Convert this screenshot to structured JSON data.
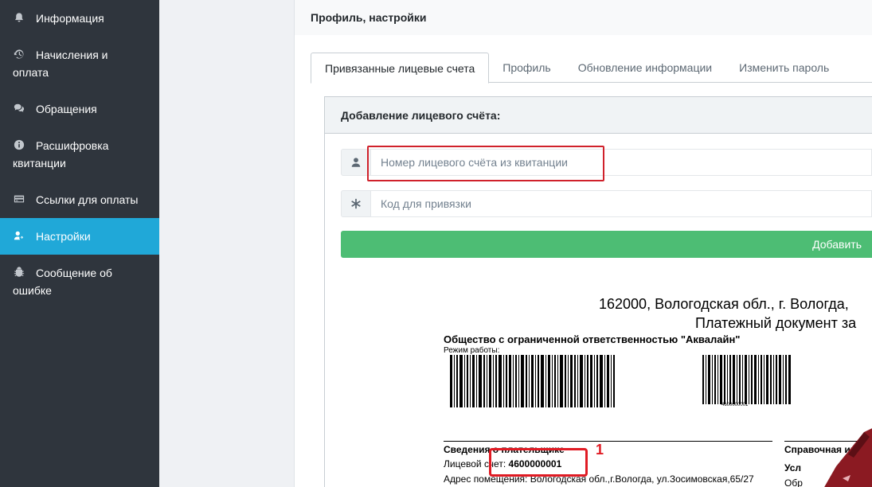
{
  "sidebar": {
    "items": [
      {
        "label": "Информация",
        "icon": "bell-icon"
      },
      {
        "label": "Начисления и оплата",
        "icon": "history-icon"
      },
      {
        "label": "Обращения",
        "icon": "comments-icon"
      },
      {
        "label": "Расшифровка квитанции",
        "icon": "info-circle-icon"
      },
      {
        "label": "Ссылки для оплаты",
        "icon": "credit-card-icon"
      },
      {
        "label": "Настройки",
        "icon": "user-gear-icon",
        "active": true
      },
      {
        "label": "Сообщение об ошибке",
        "icon": "bug-icon"
      }
    ]
  },
  "header": {
    "title": "Профиль, настройки"
  },
  "tabs": [
    {
      "label": "Привязанные лицевые счета",
      "active": true
    },
    {
      "label": "Профиль"
    },
    {
      "label": "Обновление информации"
    },
    {
      "label": "Изменить пароль"
    }
  ],
  "form": {
    "title": "Добавление лицевого счёта:",
    "account_placeholder": "Номер лицевого счёта из квитанции",
    "account_value": "",
    "code_placeholder": "Код для привязки",
    "code_value": "",
    "add_button": "Добавить"
  },
  "receipt": {
    "address_line": "162000, Вологодская обл., г. Вологда,",
    "doc_line": "Платежный документ за",
    "organization": "Общество с ограниченной ответственностью \"Аквалайн\"",
    "work_mode": "Режим работы:",
    "barcode_number": "4600000001",
    "payer_heading": "Сведения о плательщике",
    "reference_heading": "Справочная инс",
    "account_label": "Лицевой счет:",
    "account_number": "4600000001",
    "address": "Адрес помещения: Вологодская обл.,г.Вологда, ул.Зосимовская,65/27",
    "services": "Усл",
    "obr": "Обр",
    "marker": "1"
  },
  "colors": {
    "sidebar_bg": "#2f353d",
    "active_item": "#20a8d8",
    "add_button": "#4dbd74",
    "highlight": "#e01b24"
  }
}
